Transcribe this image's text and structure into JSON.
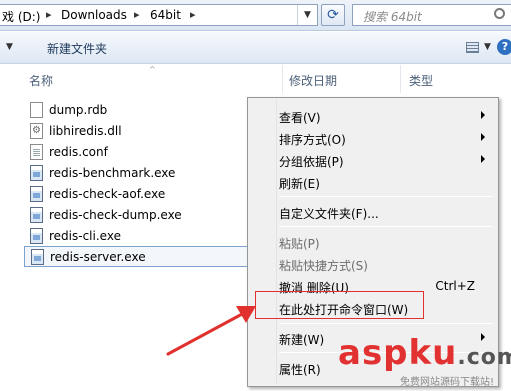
{
  "address_bar": {
    "crumbs": [
      "戏 (D:)",
      "Downloads",
      "64bit"
    ],
    "search_placeholder": "搜索 64bit"
  },
  "toolbar": {
    "new_folder_label": "新建文件夹"
  },
  "columns": {
    "name": "名称",
    "date_modified": "修改日期",
    "type": "类型"
  },
  "files": [
    {
      "name": "dump.rdb",
      "icon": "document-icon"
    },
    {
      "name": "libhiredis.dll",
      "icon": "dll-icon"
    },
    {
      "name": "redis.conf",
      "icon": "text-file-icon"
    },
    {
      "name": "redis-benchmark.exe",
      "icon": "exe-icon"
    },
    {
      "name": "redis-check-aof.exe",
      "icon": "exe-icon"
    },
    {
      "name": "redis-check-dump.exe",
      "icon": "exe-icon"
    },
    {
      "name": "redis-cli.exe",
      "icon": "exe-icon"
    },
    {
      "name": "redis-server.exe",
      "icon": "exe-icon",
      "selected": true
    }
  ],
  "context_menu": {
    "items": [
      {
        "label": "查看(V)",
        "submenu": true
      },
      {
        "label": "排序方式(O)",
        "submenu": true
      },
      {
        "label": "分组依据(P)",
        "submenu": true
      },
      {
        "label": "刷新(E)"
      },
      {
        "label": "自定义文件夹(F)..."
      },
      {
        "label": "粘贴(P)",
        "disabled": true
      },
      {
        "label": "粘贴快捷方式(S)",
        "disabled": true
      },
      {
        "label": "撤消 删除(U)",
        "shortcut": "Ctrl+Z"
      },
      {
        "label": "在此处打开命令窗口(W)",
        "highlighted": true
      },
      {
        "label": "新建(W)",
        "submenu": true
      },
      {
        "label": "属性(R)"
      }
    ]
  },
  "annotation": {
    "color": "#e0312f"
  },
  "watermark": {
    "brand": "aspku",
    "tld": ".com",
    "slogan": "免费网站源码下载站!"
  }
}
